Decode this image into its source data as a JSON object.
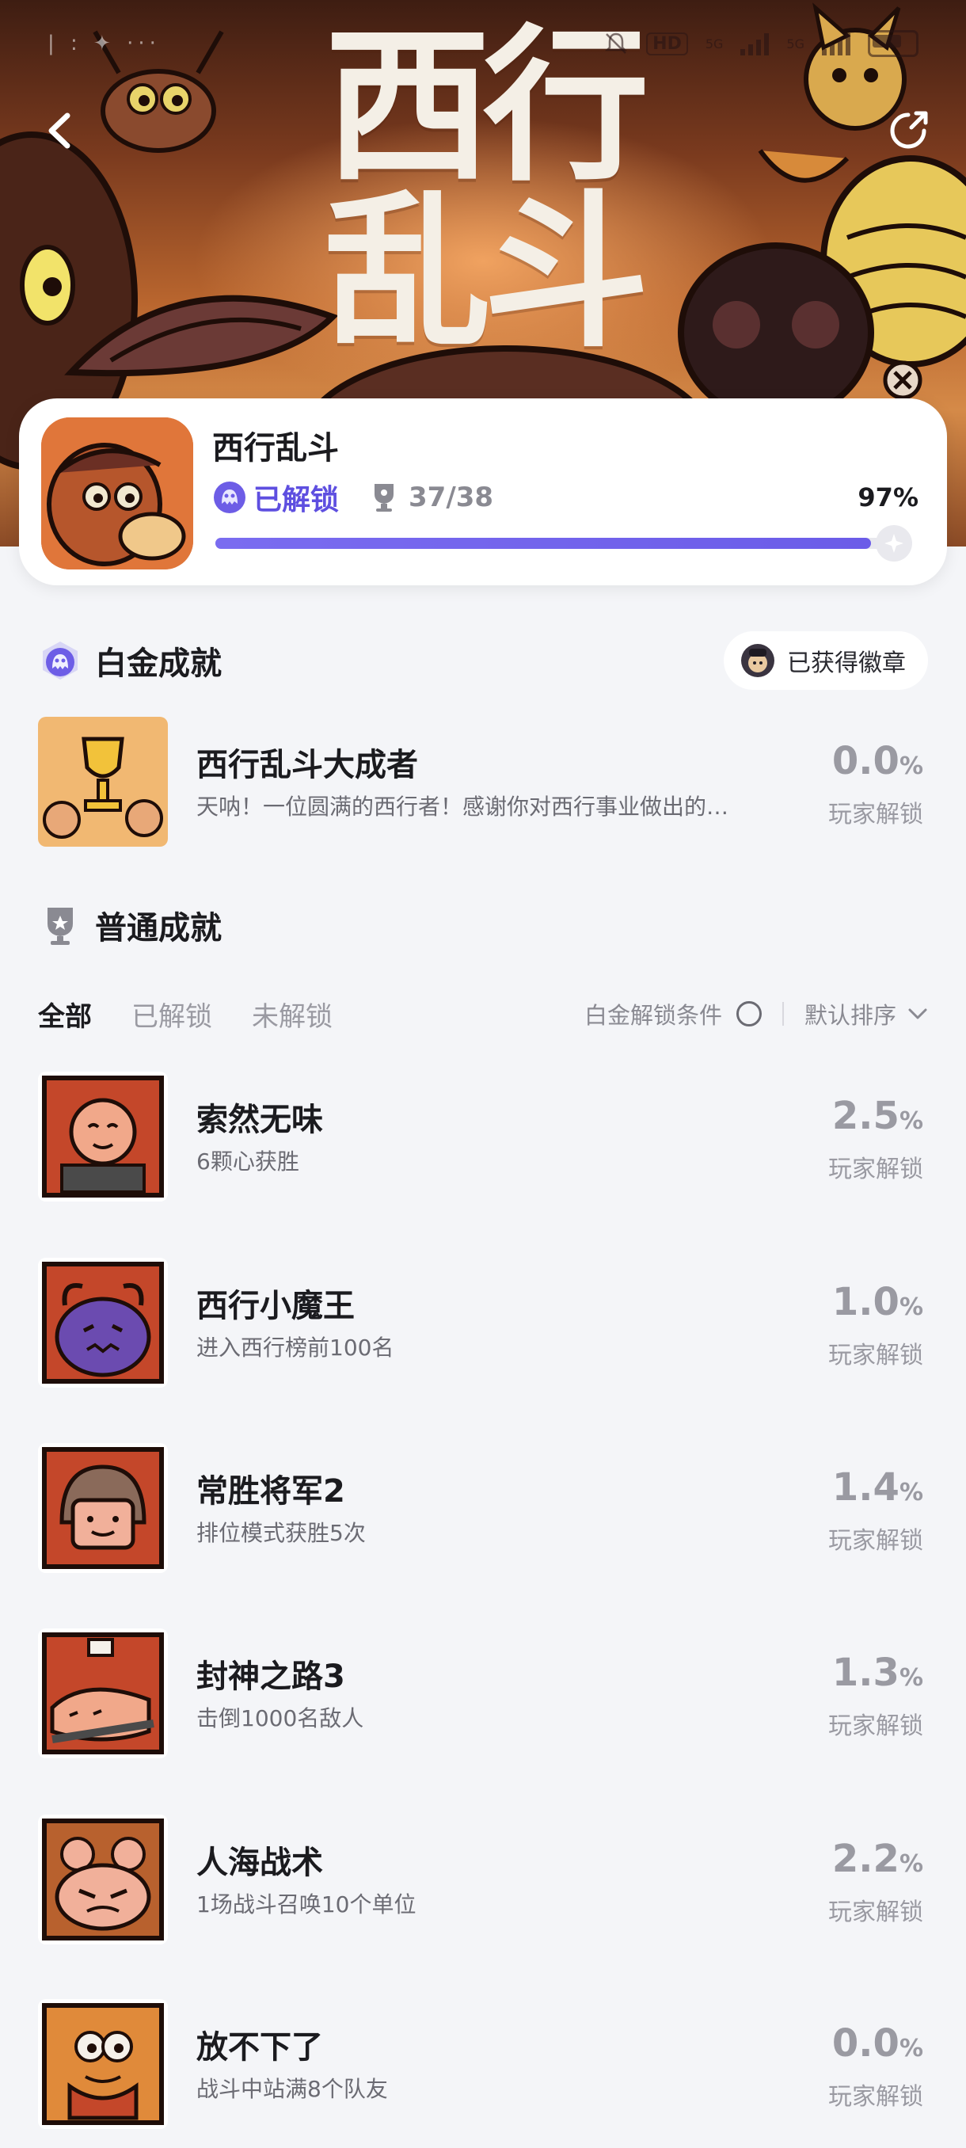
{
  "status_bar": {
    "hd_badge": "HD",
    "net1": "5G",
    "net2": "5G"
  },
  "hero": {
    "title_line1": "西行",
    "title_line2": "乱斗"
  },
  "game": {
    "name": "西行乱斗",
    "unlock_status": "已解锁",
    "trophy_count": "37/38",
    "percent": "97%",
    "progress": 0.97
  },
  "platinum": {
    "title": "白金成就",
    "badge_button": "已获得徽章",
    "item": {
      "title": "西行乱斗大成者",
      "desc": "天呐！一位圆满的西行者！感谢你对西行事业做出的…",
      "pct": "0.0",
      "unit": "%",
      "sub": "玩家解锁"
    }
  },
  "normal": {
    "title": "普通成就",
    "tabs": [
      "全部",
      "已解锁",
      "未解锁"
    ],
    "condition_label": "白金解锁条件",
    "sort_label": "默认排序",
    "items": [
      {
        "title": "索然无味",
        "desc": "6颗心获胜",
        "pct": "2.5",
        "unit": "%",
        "sub": "玩家解锁"
      },
      {
        "title": "西行小魔王",
        "desc": "进入西行榜前100名",
        "pct": "1.0",
        "unit": "%",
        "sub": "玩家解锁"
      },
      {
        "title": "常胜将军2",
        "desc": "排位模式获胜5次",
        "pct": "1.4",
        "unit": "%",
        "sub": "玩家解锁"
      },
      {
        "title": "封神之路3",
        "desc": "击倒1000名敌人",
        "pct": "1.3",
        "unit": "%",
        "sub": "玩家解锁"
      },
      {
        "title": "人海战术",
        "desc": "1场战斗召唤10个单位",
        "pct": "2.2",
        "unit": "%",
        "sub": "玩家解锁"
      },
      {
        "title": "放不下了",
        "desc": "战斗中站满8个队友",
        "pct": "0.0",
        "unit": "%",
        "sub": "玩家解锁"
      }
    ]
  },
  "colors": {
    "accent": "#5e4fe0",
    "muted": "#9a9aa2",
    "background": "#f4f5f8"
  }
}
